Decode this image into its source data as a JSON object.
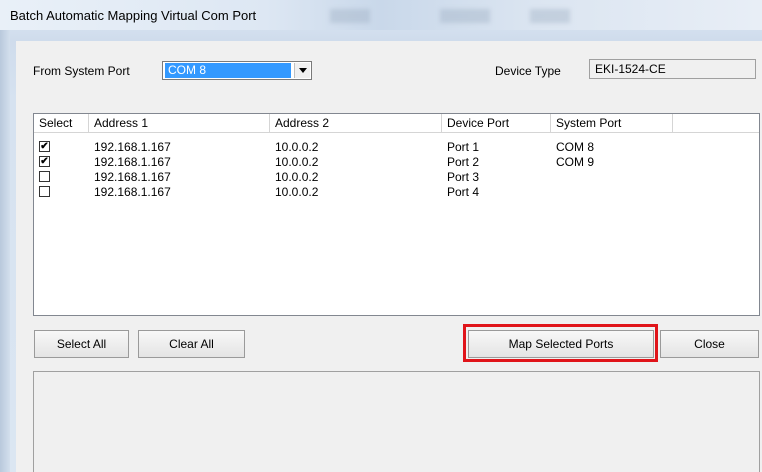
{
  "window": {
    "title": "Batch Automatic Mapping Virtual Com Port"
  },
  "form": {
    "from_port_label": "From System Port",
    "from_port_value": "COM 8",
    "device_type_label": "Device Type",
    "device_type_value": "EKI-1524-CE"
  },
  "table": {
    "headers": [
      "Select",
      "Address 1",
      "Address 2",
      "Device Port",
      "System Port"
    ],
    "rows": [
      {
        "checked": true,
        "check": "✔",
        "address1": "192.168.1.167",
        "address2": "10.0.0.2",
        "device_port": "Port 1",
        "system_port": "COM 8"
      },
      {
        "checked": true,
        "check": "✔",
        "address1": "192.168.1.167",
        "address2": "10.0.0.2",
        "device_port": "Port 2",
        "system_port": "COM 9"
      },
      {
        "checked": false,
        "check": "",
        "address1": "192.168.1.167",
        "address2": "10.0.0.2",
        "device_port": "Port 3",
        "system_port": ""
      },
      {
        "checked": false,
        "check": "",
        "address1": "192.168.1.167",
        "address2": "10.0.0.2",
        "device_port": "Port 4",
        "system_port": ""
      }
    ]
  },
  "buttons": {
    "select_all": "Select All",
    "clear_all": "Clear All",
    "map_selected": "Map Selected Ports",
    "close": "Close"
  },
  "colors": {
    "highlight": "#e0141a",
    "selection": "#3399ff"
  }
}
